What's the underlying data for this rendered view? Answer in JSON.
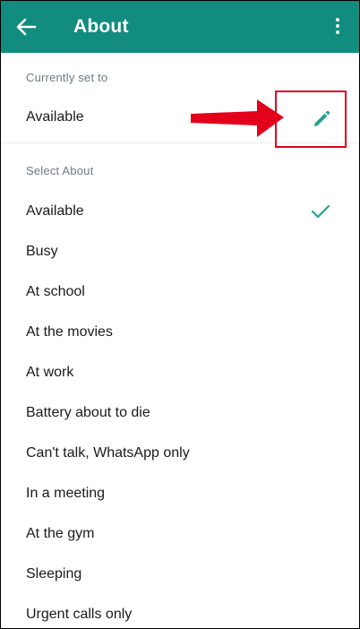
{
  "header": {
    "title": "About",
    "back_icon": "arrow-back-icon",
    "menu_icon": "more-vert-icon",
    "bg_color": "#128c7e"
  },
  "current": {
    "section_label": "Currently set to",
    "value": "Available",
    "edit_icon": "pencil-icon"
  },
  "select": {
    "section_label": "Select About",
    "selected": "Available",
    "items": [
      {
        "label": "Available"
      },
      {
        "label": "Busy"
      },
      {
        "label": "At school"
      },
      {
        "label": "At the movies"
      },
      {
        "label": "At work"
      },
      {
        "label": "Battery about to die"
      },
      {
        "label": "Can't talk, WhatsApp only"
      },
      {
        "label": "In a meeting"
      },
      {
        "label": "At the gym"
      },
      {
        "label": "Sleeping"
      },
      {
        "label": "Urgent calls only"
      }
    ]
  },
  "annotation": {
    "arrow_color": "#e3001b",
    "box_color": "#e3001b"
  },
  "colors": {
    "accent": "#128c7e",
    "check": "#25a18e"
  }
}
